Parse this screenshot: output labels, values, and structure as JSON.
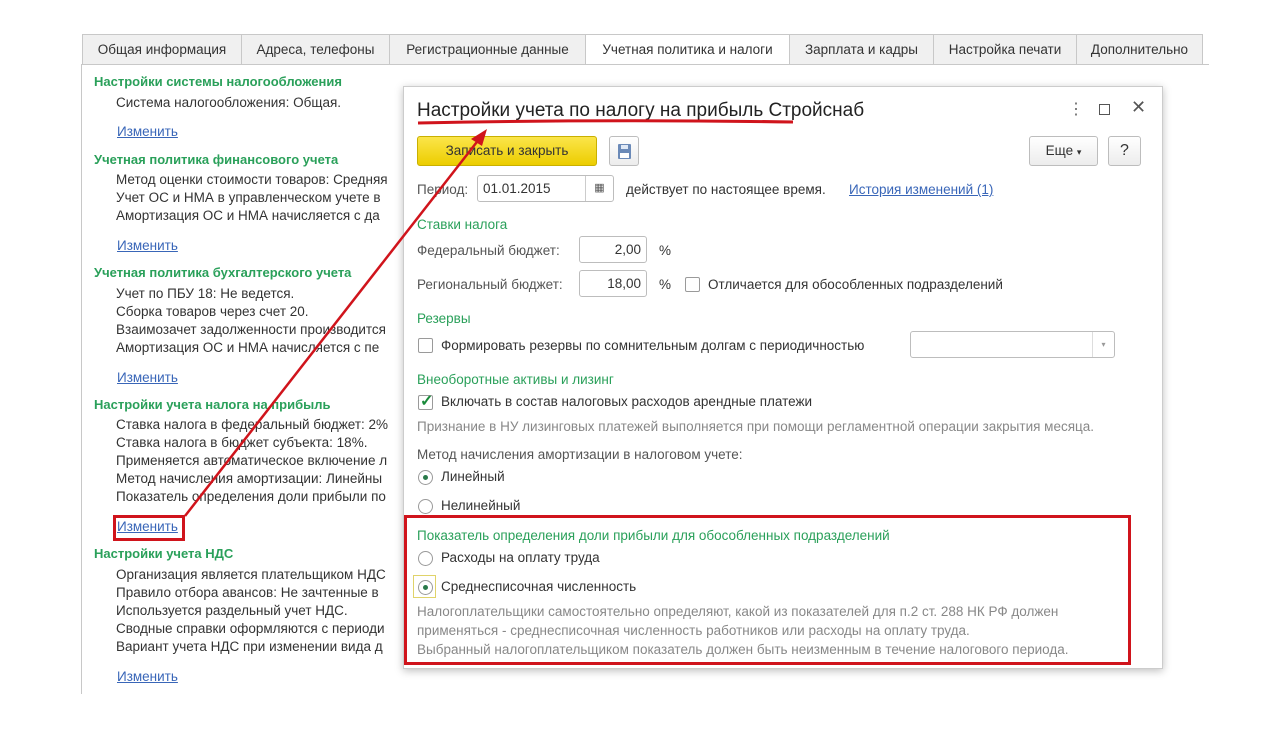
{
  "tabs": [
    "Общая информация",
    "Адреса, телефоны",
    "Регистрационные данные",
    "Учетная политика и налоги",
    "Зарплата и кадры",
    "Настройка печати",
    "Дополнительно"
  ],
  "left": {
    "sections": [
      {
        "title": "Настройки системы налогообложения",
        "lines": [
          "Система налогообложения: Общая."
        ],
        "link": "Изменить"
      },
      {
        "title": "Учетная политика финансового учета",
        "lines": [
          "Метод оценки стоимости товаров: Средняя",
          "Учет ОС и НМА в управленческом учете в",
          "Амортизация ОС и НМА начисляется с да"
        ],
        "link": "Изменить"
      },
      {
        "title": "Учетная политика бухгалтерского учета",
        "lines": [
          "Учет по ПБУ 18: Не ведется.",
          "Сборка товаров через счет 20.",
          "Взаимозачет задолженности производится",
          "Амортизация ОС и НМА начисляется с пе"
        ],
        "link": "Изменить"
      },
      {
        "title": "Настройки учета налога на прибыль",
        "lines": [
          "Ставка налога в федеральный бюджет: 2%",
          "Ставка налога в бюджет субъекта: 18%.",
          "Применяется автоматическое включение л",
          "Метод начисления амортизации: Линейны",
          "Показатель определения доли прибыли по"
        ],
        "link": "Изменить"
      },
      {
        "title": "Настройки учета НДС",
        "lines": [
          "Организация является плательщиком НДС",
          "Правило отбора авансов: Не зачтенные в",
          "Используется раздельный учет НДС.",
          "Сводные справки оформляются с периоди",
          "Вариант учета НДС при изменении вида д"
        ],
        "link": "Изменить"
      }
    ]
  },
  "dialog": {
    "title": "Настройки учета по налогу на прибыль Стройснаб",
    "save_close": "Записать и закрыть",
    "more": "Еще",
    "help": "?",
    "period_label": "Период:",
    "period_value": "01.01.2015",
    "period_note": "действует по настоящее время.",
    "history_link": "История изменений (1)",
    "rates_header": "Ставки налога",
    "federal_label": "Федеральный бюджет:",
    "federal_value": "2,00",
    "regional_label": "Региональный бюджет:",
    "regional_value": "18,00",
    "percent": "%",
    "differs_label": "Отличается для обособленных подразделений",
    "reserves_header": "Резервы",
    "reserves_label": "Формировать резервы по сомнительным долгам с периодичностью",
    "assets_header": "Внеоборотные активы и лизинг",
    "lease_label": "Включать в состав налоговых расходов арендные платежи",
    "lease_note": "Признание в НУ лизинговых платежей выполняется при помощи регламентной операции закрытия месяца.",
    "amort_label": "Метод начисления амортизации в налоговом учете:",
    "amort_linear": "Линейный",
    "amort_nonlinear": "Нелинейный",
    "share_header": "Показатель определения доли прибыли для обособленных подразделений",
    "share_opt1": "Расходы на оплату труда",
    "share_opt2": "Среднесписочная численность",
    "note1": "Налогоплательщики самостоятельно определяют, какой из показателей для п.2 ст. 288 НК РФ должен",
    "note2": "применяться - среднесписочная численность работников или расходы на оплату труда.",
    "note3": "Выбранный налогоплательщиком показатель должен быть неизменным в течение налогового периода."
  },
  "colors": {
    "accent_green": "#2aa05a",
    "link": "#3966b8",
    "annotation_red": "#d0141c",
    "button_yellow": "#f5d800"
  }
}
